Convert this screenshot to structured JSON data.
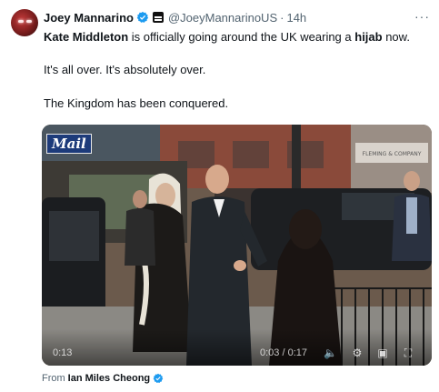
{
  "author": {
    "name": "Joey Mannarino",
    "handle": "@JoeyMannarinoUS",
    "separator": "·",
    "time": "14h"
  },
  "tweet": {
    "line1_bold1": "Kate Middleton",
    "line1_mid": " is officially going around the UK wearing a ",
    "line1_bold2": "hijab",
    "line1_end": " now.",
    "line2": "It's all over. It's absolutely over.",
    "line3": "The Kingdom has been conquered."
  },
  "media": {
    "watermark": "Mail",
    "elapsed": "0:13",
    "timecode": "0:03 / 0:17",
    "shop_sign": "FLEMING & COMPANY"
  },
  "attribution": {
    "prefix": "From",
    "source": "Ian Miles Cheong"
  },
  "icons": [
    "verified-badge-icon",
    "affiliate-badge-icon",
    "more-options-icon",
    "volume-icon",
    "settings-gear-icon",
    "picture-in-picture-icon",
    "fullscreen-icon"
  ],
  "colors": {
    "verified": "#1d9bf0",
    "muted_text": "#536471",
    "text": "#0f1419"
  }
}
